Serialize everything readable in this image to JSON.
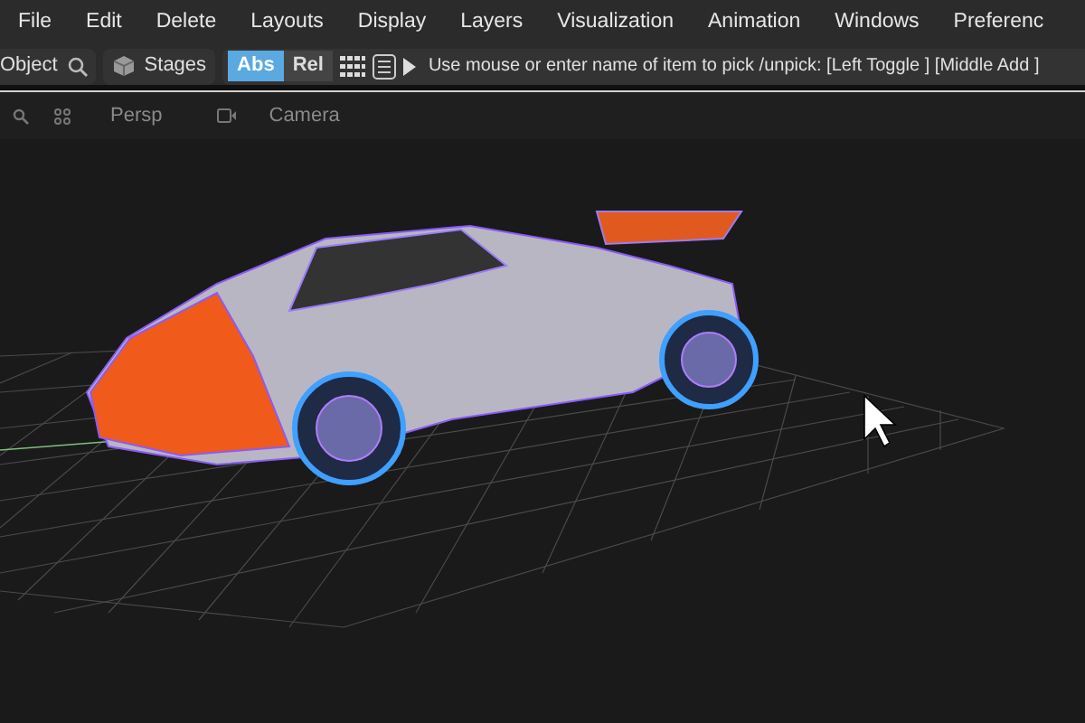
{
  "menu_bar": {
    "items": [
      "File",
      "Edit",
      "Delete",
      "Layouts",
      "Display",
      "Layers",
      "Visualization",
      "Animation",
      "Windows",
      "Preferenc"
    ]
  },
  "toolbar": {
    "object_label": "Object",
    "stages_label": "Stages",
    "mode_toggle": [
      {
        "label": "Abs",
        "selected": true
      },
      {
        "label": "Rel",
        "selected": false
      }
    ],
    "prompt": "Use mouse or enter name of item to pick /unpick: [Left Toggle ] [Middle Add ]"
  },
  "viewport": {
    "view_label": "Persp",
    "camera_label": "Camera"
  }
}
